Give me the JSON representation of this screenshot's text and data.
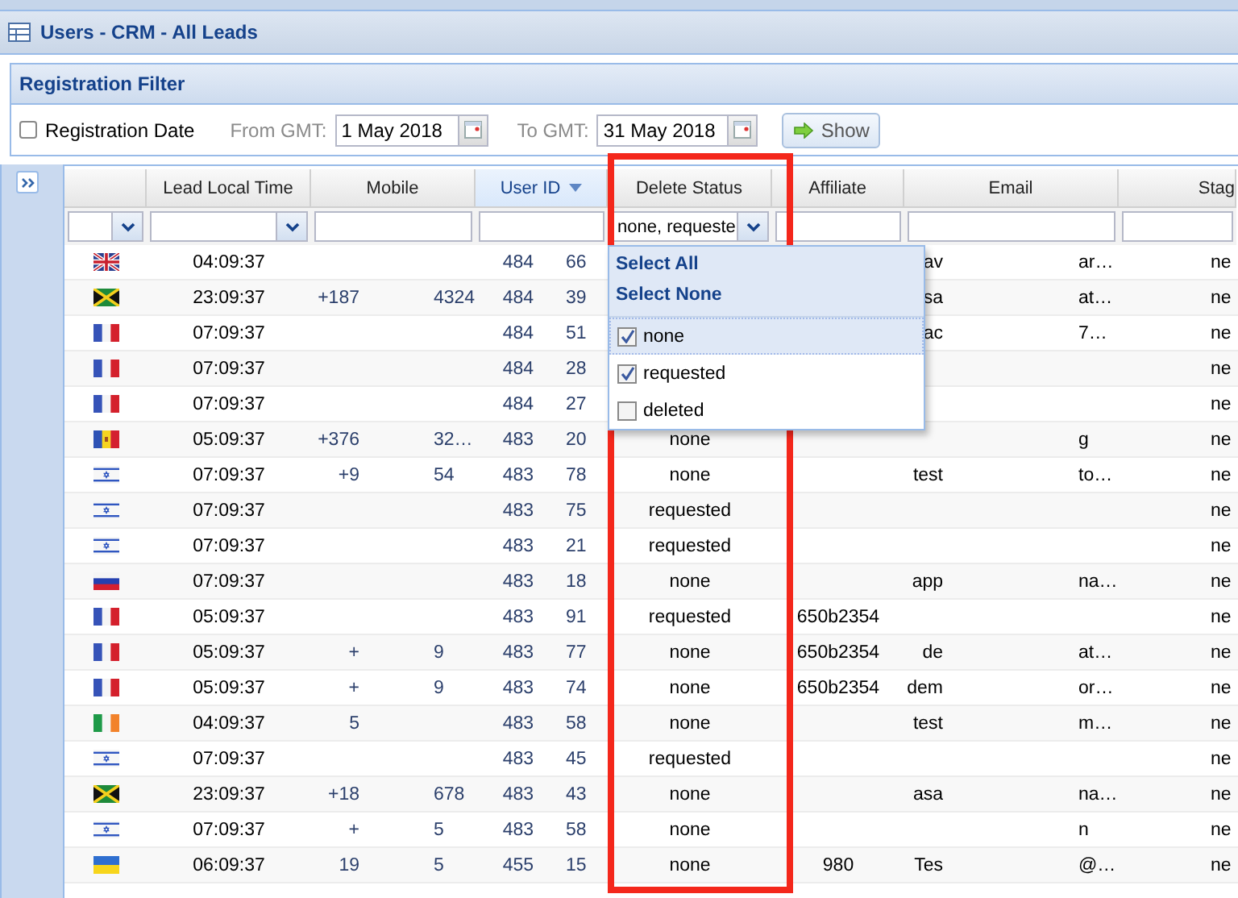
{
  "window": {
    "title": "Users - CRM - All Leads"
  },
  "filter": {
    "title": "Registration Filter",
    "checkbox": {
      "label": "Registration Date",
      "checked": false
    },
    "from": {
      "label": "From GMT:",
      "value": "1 May 2018"
    },
    "to": {
      "label": "To GMT:",
      "value": "31 May 2018"
    },
    "button": "Show"
  },
  "table": {
    "columns": [
      {
        "sorted": false
      },
      {
        "label": "Lead Local Time",
        "sorted": false
      },
      {
        "label": "Mobile",
        "sorted": false
      },
      {
        "label": "User ID",
        "sorted": true
      },
      {
        "label": "Delete Status",
        "sorted": false
      },
      {
        "label": "Affiliate",
        "sorted": false
      },
      {
        "label": "Email",
        "sorted": false
      },
      {
        "label": "Stag",
        "sorted": false
      }
    ],
    "filters": [
      {
        "kind": "combo"
      },
      {
        "kind": "combo"
      },
      {
        "kind": "text"
      },
      {
        "kind": "text"
      },
      {
        "kind": "combo",
        "value": "none, requeste"
      },
      {
        "kind": "text"
      },
      {
        "kind": "text"
      },
      {
        "kind": "text"
      }
    ],
    "rows": [
      {
        "kind": "gb",
        "time": "04:09:37",
        "user_id": {
          "before": "484",
          "after": "66"
        },
        "email": {
          "before": "av",
          "after": "ar…"
        },
        "stage": "ne"
      },
      {
        "kind": "jm",
        "time": "23:09:37",
        "mobile": {
          "before": "+187",
          "after": "4324"
        },
        "user_id": {
          "before": "484",
          "after": "39"
        },
        "email": {
          "before": "sa",
          "after": "at…"
        },
        "stage": "ne"
      },
      {
        "kind": "fr",
        "time": "07:09:37",
        "user_id": {
          "before": "484",
          "after": "51"
        },
        "email": {
          "before": "ac",
          "after": "7…"
        },
        "stage": "ne"
      },
      {
        "kind": "fr",
        "time": "07:09:37",
        "user_id": {
          "before": "484",
          "after": "28"
        },
        "stage": "ne"
      },
      {
        "kind": "fr",
        "time": "07:09:37",
        "user_id": {
          "before": "484",
          "after": "27"
        },
        "stage": "ne"
      },
      {
        "kind": "md",
        "time": "05:09:37",
        "mobile": {
          "before": "+376",
          "after": "32…"
        },
        "user_id": {
          "before": "483",
          "after": "20"
        },
        "status": "none",
        "email": {
          "after": "g"
        },
        "stage": "ne"
      },
      {
        "kind": "il",
        "time": "07:09:37",
        "mobile": {
          "before": "+9",
          "after": "54"
        },
        "user_id": {
          "before": "483",
          "after": "78"
        },
        "status": "none",
        "email": {
          "before": "test",
          "after": "to…"
        },
        "stage": "ne"
      },
      {
        "kind": "il",
        "time": "07:09:37",
        "user_id": {
          "before": "483",
          "after": "75"
        },
        "status": "requested",
        "stage": "ne"
      },
      {
        "kind": "il",
        "time": "07:09:37",
        "user_id": {
          "before": "483",
          "after": "21"
        },
        "status": "requested",
        "stage": "ne"
      },
      {
        "kind": "ru",
        "time": "07:09:37",
        "user_id": {
          "before": "483",
          "after": "18"
        },
        "status": "none",
        "email": {
          "before": "app",
          "after": "na…"
        },
        "stage": "ne"
      },
      {
        "kind": "fr",
        "time": "05:09:37",
        "user_id": {
          "before": "483",
          "after": "91"
        },
        "status": "requested",
        "affiliate": "650b2354",
        "stage": "ne"
      },
      {
        "kind": "fr",
        "time": "05:09:37",
        "mobile": {
          "before": "+",
          "after": "9"
        },
        "user_id": {
          "before": "483",
          "after": "77"
        },
        "status": "none",
        "affiliate": "650b2354",
        "email": {
          "before": "de",
          "after": "at…"
        },
        "stage": "ne"
      },
      {
        "kind": "fr",
        "time": "05:09:37",
        "mobile": {
          "before": "+",
          "after": "9"
        },
        "user_id": {
          "before": "483",
          "after": "74"
        },
        "status": "none",
        "affiliate": "650b2354",
        "email": {
          "before": "dem",
          "after": "or…"
        },
        "stage": "ne"
      },
      {
        "kind": "ie",
        "time": "04:09:37",
        "mobile": {
          "before": "5"
        },
        "user_id": {
          "before": "483",
          "after": "58"
        },
        "status": "none",
        "email": {
          "before": "test",
          "after": "m…"
        },
        "stage": "ne"
      },
      {
        "kind": "il",
        "time": "07:09:37",
        "user_id": {
          "before": "483",
          "after": "45"
        },
        "status": "requested",
        "stage": "ne"
      },
      {
        "kind": "jm",
        "time": "23:09:37",
        "mobile": {
          "before": "+18",
          "after": "678"
        },
        "user_id": {
          "before": "483",
          "after": "43"
        },
        "status": "none",
        "email": {
          "before": "asa",
          "after": "na…"
        },
        "stage": "ne"
      },
      {
        "kind": "il",
        "time": "07:09:37",
        "mobile": {
          "before": "+",
          "after": "5"
        },
        "user_id": {
          "before": "483",
          "after": "58"
        },
        "status": "none",
        "email": {
          "after": "n"
        },
        "stage": "ne"
      },
      {
        "kind": "ua",
        "time": "06:09:37",
        "mobile": {
          "before": "19",
          "after": "5"
        },
        "user_id": {
          "before": "455",
          "after": "15"
        },
        "status": "none",
        "affiliate": "980",
        "email": {
          "before": "Tes",
          "after": "@…"
        },
        "stage": "ne"
      }
    ]
  },
  "status_dropdown": {
    "actions": [
      "Select All",
      "Select None"
    ],
    "options": [
      {
        "label": "none",
        "checked": true,
        "highlighted": true
      },
      {
        "label": "requested",
        "checked": true,
        "highlighted": false
      },
      {
        "label": "deleted",
        "checked": false,
        "highlighted": false
      }
    ]
  }
}
